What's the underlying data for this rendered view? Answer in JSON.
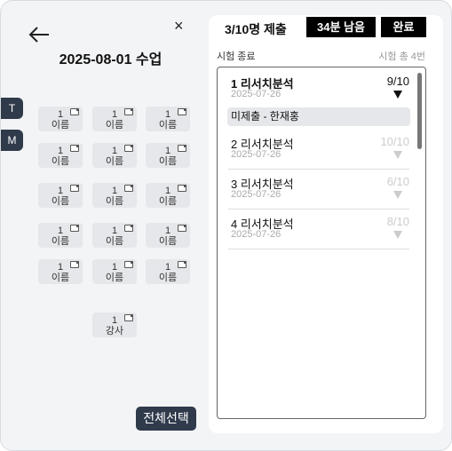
{
  "header": {
    "title": "2025-08-01 수업",
    "close_glyph": "×"
  },
  "side_tabs": [
    {
      "label": "T"
    },
    {
      "label": "M"
    }
  ],
  "seats": [
    {
      "num": "1",
      "name": "이름"
    },
    {
      "num": "1",
      "name": "이름"
    },
    {
      "num": "1",
      "name": "이름"
    },
    {
      "num": "1",
      "name": "이름"
    },
    {
      "num": "1",
      "name": "이름"
    },
    {
      "num": "1",
      "name": "이름"
    },
    {
      "num": "1",
      "name": "이름"
    },
    {
      "num": "1",
      "name": "이름"
    },
    {
      "num": "1",
      "name": "이름"
    },
    {
      "num": "1",
      "name": "이름"
    },
    {
      "num": "1",
      "name": "이름"
    },
    {
      "num": "1",
      "name": "이름"
    },
    {
      "num": "1",
      "name": "이름"
    },
    {
      "num": "1",
      "name": "이름"
    },
    {
      "num": "1",
      "name": "이름"
    }
  ],
  "teacher_seat": {
    "num": "1",
    "name": "강사"
  },
  "select_all_label": "전체선택",
  "panel": {
    "submitted": "3/10명 제출",
    "time_left": "34분 남음",
    "done_label": "완료",
    "status_label": "시험 종료",
    "total_label": "시험 총 4번",
    "exams": [
      {
        "name": "1 리서치분석",
        "date": "2025-07-26",
        "score": "9/10",
        "active": true
      },
      {
        "name": "2 리서치분석",
        "date": "2025-07-26",
        "score": "10/10",
        "active": false
      },
      {
        "name": "3 리서치분석",
        "date": "2025-07-26",
        "score": "6/10",
        "active": false
      },
      {
        "name": "4 리서치분석",
        "date": "2025-07-26",
        "score": "8/10",
        "active": false
      }
    ],
    "unsubmitted_label": "미제출 - 한재홍"
  },
  "colors": {
    "dark": "#2f3a4b",
    "faded": "#cccccc"
  }
}
